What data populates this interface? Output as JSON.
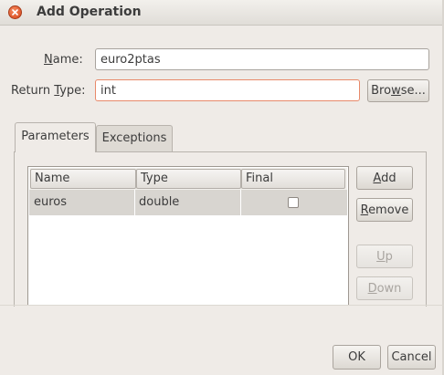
{
  "window": {
    "title": "Add Operation"
  },
  "form": {
    "name_label_prefix": "",
    "name_label_mnemonic": "N",
    "name_label_rest": "ame:",
    "name_value": "euro2ptas",
    "return_label_pre": "Return ",
    "return_label_mnemonic": "T",
    "return_label_rest": "ype:",
    "return_value": "int",
    "browse_pre": "Bro",
    "browse_mnemonic": "w",
    "browse_rest": "se..."
  },
  "tabs": [
    {
      "label": "Parameters",
      "active": true
    },
    {
      "label": "Exceptions",
      "active": false
    }
  ],
  "table": {
    "columns": [
      "Name",
      "Type",
      "Final"
    ],
    "rows": [
      {
        "name": "euros",
        "type": "double",
        "final": false
      }
    ]
  },
  "side_buttons": {
    "add_mnemonic": "A",
    "add_rest": "dd",
    "remove_mnemonic": "R",
    "remove_rest": "emove",
    "up_mnemonic": "U",
    "up_rest": "p",
    "down_mnemonic": "D",
    "down_rest": "own"
  },
  "footer": {
    "ok_label": "OK",
    "cancel_label": "Cancel"
  },
  "colors": {
    "background": "#efebe7",
    "focus_border": "#e8896a",
    "close_button": "#d6441a",
    "selected_row": "#d8d5d0"
  }
}
